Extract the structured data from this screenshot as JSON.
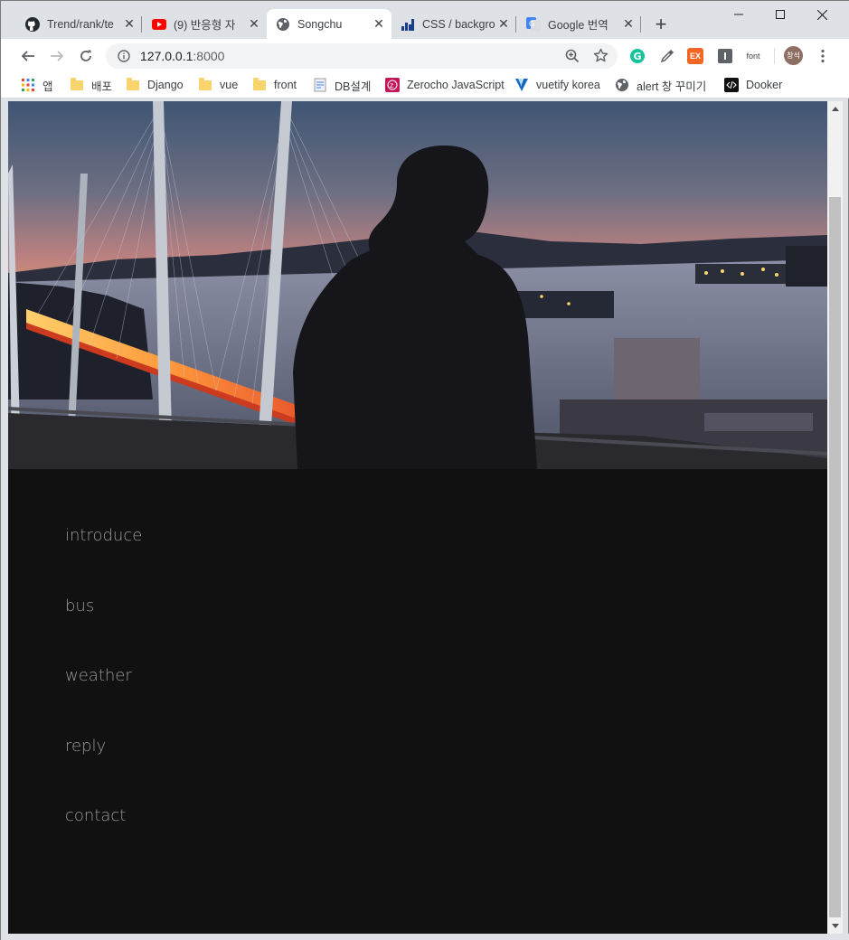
{
  "tabs": [
    {
      "title": "Trend/rank/te",
      "icon": "github-icon"
    },
    {
      "title": "(9) 반응형 자",
      "icon": "youtube-icon"
    },
    {
      "title": "Songchu",
      "icon": "globe-icon",
      "active": true
    },
    {
      "title": "CSS / backgro",
      "icon": "css-site-icon"
    },
    {
      "title": "Google 번역",
      "icon": "google-translate-icon"
    }
  ],
  "newtab_label": "+",
  "address": {
    "host": "127.0.0.1",
    "port": ":8000"
  },
  "extensions": {
    "font_label": "font",
    "profile_initials": "창석",
    "ext_label": "EX"
  },
  "bookmarks": [
    {
      "label": "앱",
      "icon": "apps-icon"
    },
    {
      "label": "배포",
      "icon": "folder-icon"
    },
    {
      "label": "Django",
      "icon": "folder-icon"
    },
    {
      "label": "vue",
      "icon": "folder-icon"
    },
    {
      "label": "front",
      "icon": "folder-icon"
    },
    {
      "label": "DB설계",
      "icon": "document-icon"
    },
    {
      "label": "Zerocho JavaScript",
      "icon": "zerocho-icon"
    },
    {
      "label": "vuetify korea",
      "icon": "vuetify-icon"
    },
    {
      "label": "alert 창 꾸미기",
      "icon": "globe-icon"
    },
    {
      "label": "Dooker",
      "icon": "code-icon"
    }
  ],
  "page": {
    "menu": [
      "introduce",
      "bus",
      "weather",
      "reply",
      "contact"
    ]
  },
  "colors": {
    "page_bg": "#111111",
    "menu_text": "#9a9a9a",
    "chrome_bg": "#dee1e6"
  }
}
